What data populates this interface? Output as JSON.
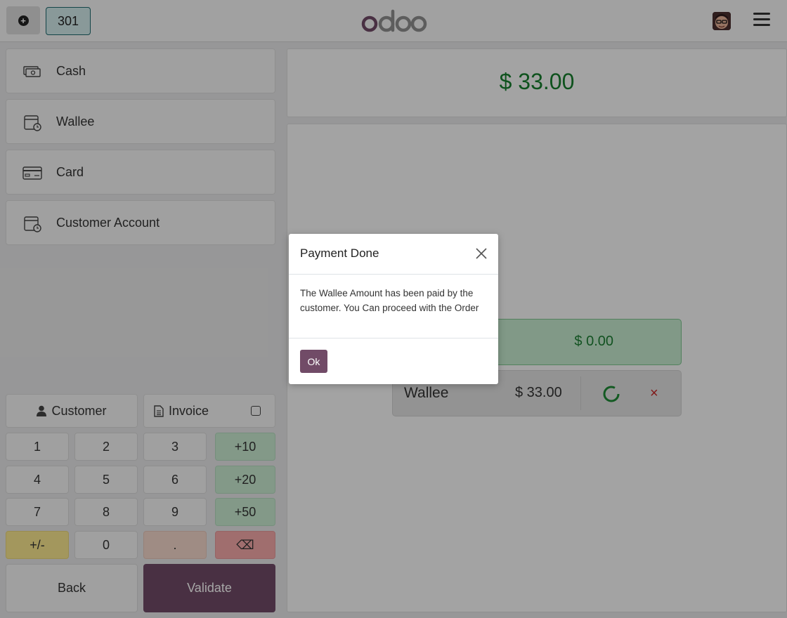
{
  "header": {
    "order_tab": "301",
    "brand": "odoo"
  },
  "payment_methods": [
    {
      "label": "Cash",
      "icon": "cash-icon"
    },
    {
      "label": "Wallee",
      "icon": "payment-terminal-icon"
    },
    {
      "label": "Card",
      "icon": "credit-card-icon"
    },
    {
      "label": "Customer Account",
      "icon": "payment-terminal-icon"
    }
  ],
  "actions": {
    "customer_label": "Customer",
    "invoice_label": "Invoice"
  },
  "numpad": {
    "keys": [
      "1",
      "2",
      "3",
      "+10",
      "4",
      "5",
      "6",
      "+20",
      "7",
      "8",
      "9",
      "+50",
      "+/-",
      "0",
      ".",
      "⌫"
    ]
  },
  "footer": {
    "back_label": "Back",
    "validate_label": "Validate"
  },
  "summary": {
    "total": "$ 33.00",
    "remaining": "$ 0.00"
  },
  "payment_line": {
    "method": "Wallee",
    "amount": "$ 33.00",
    "remove_symbol": "×"
  },
  "dialog": {
    "title": "Payment Done",
    "message": "The Wallee Amount has been paid by the customer. You Can proceed with the Order",
    "ok_label": "Ok"
  },
  "colors": {
    "brand": "#714b67",
    "success": "#167e2d",
    "danger": "#c62828"
  }
}
